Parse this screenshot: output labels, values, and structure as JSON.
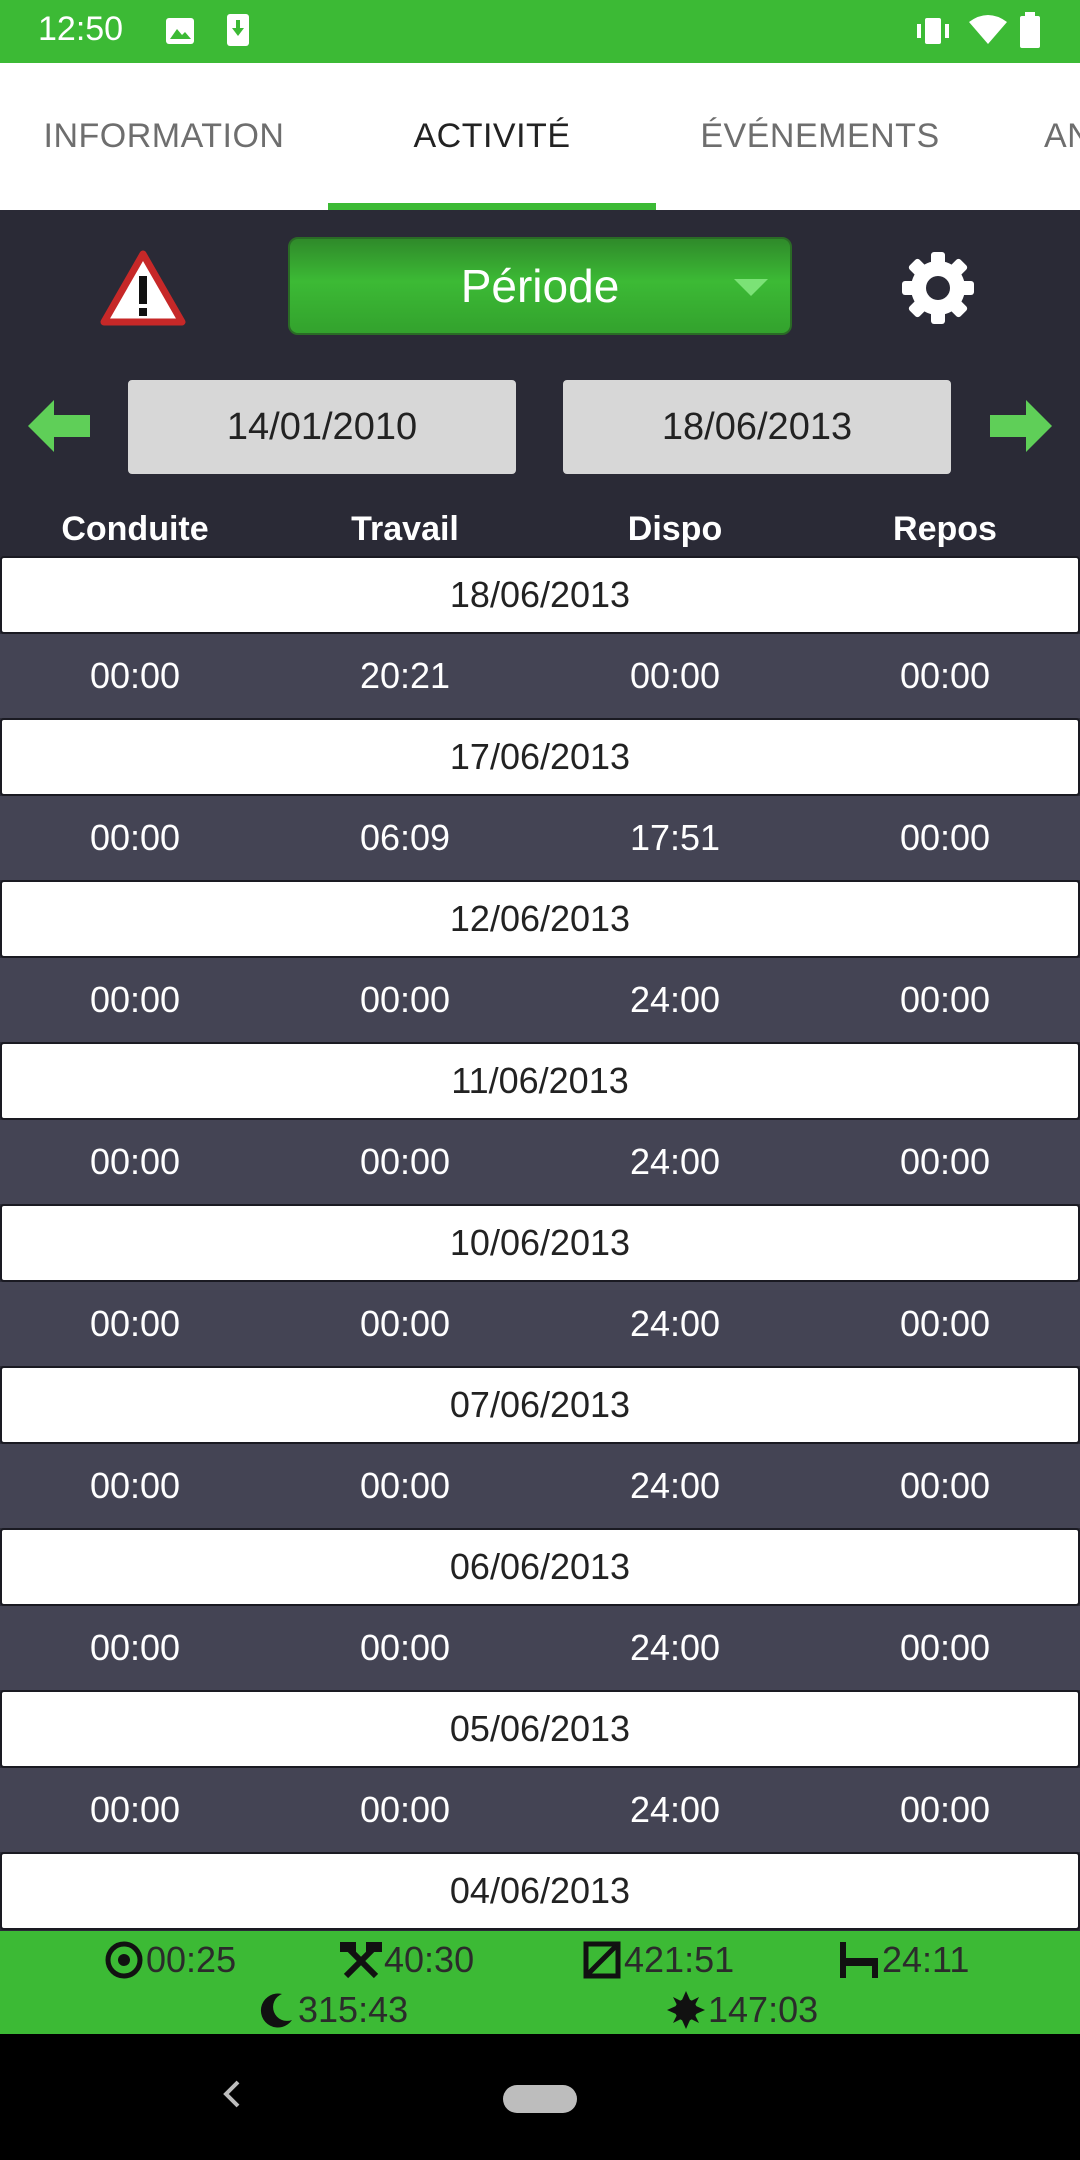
{
  "status_bar": {
    "time": "12:50"
  },
  "tabs": [
    {
      "label": "INFORMATION"
    },
    {
      "label": "ACTIVITÉ"
    },
    {
      "label": "ÉVÉNEMENTS"
    },
    {
      "label": "AN"
    }
  ],
  "toolbar": {
    "period_label": "Période"
  },
  "date_range": {
    "start": "14/01/2010",
    "end": "18/06/2013"
  },
  "columns": [
    "Conduite",
    "Travail",
    "Dispo",
    "Repos"
  ],
  "entries": [
    {
      "date": "18/06/2013",
      "values": [
        "00:00",
        "20:21",
        "00:00",
        "00:00"
      ]
    },
    {
      "date": "17/06/2013",
      "values": [
        "00:00",
        "06:09",
        "17:51",
        "00:00"
      ]
    },
    {
      "date": "12/06/2013",
      "values": [
        "00:00",
        "00:00",
        "24:00",
        "00:00"
      ]
    },
    {
      "date": "11/06/2013",
      "values": [
        "00:00",
        "00:00",
        "24:00",
        "00:00"
      ]
    },
    {
      "date": "10/06/2013",
      "values": [
        "00:00",
        "00:00",
        "24:00",
        "00:00"
      ]
    },
    {
      "date": "07/06/2013",
      "values": [
        "00:00",
        "00:00",
        "24:00",
        "00:00"
      ]
    },
    {
      "date": "06/06/2013",
      "values": [
        "00:00",
        "00:00",
        "24:00",
        "00:00"
      ]
    },
    {
      "date": "05/06/2013",
      "values": [
        "00:00",
        "00:00",
        "24:00",
        "00:00"
      ]
    },
    {
      "date": "04/06/2013",
      "values": null
    }
  ],
  "summary": {
    "driving": "00:25",
    "work": "40:30",
    "availability": "421:51",
    "rest": "24:11",
    "night": "315:43",
    "day": "147:03"
  },
  "colors": {
    "accent": "#3cba35",
    "background": "#2a2a36",
    "row": "#444454"
  }
}
